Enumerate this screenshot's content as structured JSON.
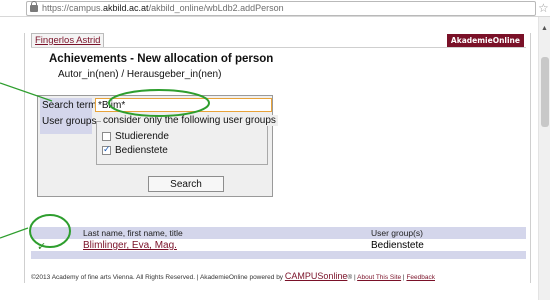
{
  "browser": {
    "url_prefix": "https://campus.",
    "url_host": "akbild.ac.at",
    "url_path": "/akbild_online/wbLdb2.addPerson"
  },
  "header": {
    "user_tab": "Fingerlos Astrid",
    "brand_badge": "AkademieOnline"
  },
  "main": {
    "title": "Achievements - New allocation of person",
    "subtitle": "Autor_in(nen) / Herausgeber_in(nen)"
  },
  "search": {
    "term_label": "Search term",
    "term_value": "*Blim*",
    "groups_label": "User groups",
    "groups_legend": "consider only the following user groups",
    "options": [
      {
        "label": "Studierende",
        "checked": false
      },
      {
        "label": "Bedienstete",
        "checked": true
      }
    ],
    "button_label": "Search"
  },
  "results": {
    "headers": [
      "Last name, first name, title",
      "User group(s)"
    ],
    "rows": [
      {
        "selected_mark": "✓",
        "name": "Blimlinger, Eva, Mag.",
        "group": "Bedienstete"
      }
    ]
  },
  "footer": {
    "copyright": "©2013 Academy of fine arts Vienna. All Rights Reserved. | AkademieOnline powered by ",
    "powered_brand": "CAMPUSonline",
    "registered": "®",
    "separator": " | ",
    "about_link": "About This Site",
    "feedback_link": "Feedback"
  },
  "colors": {
    "brand": "#7a1128",
    "label_bg": "#d4d6eb",
    "input_focus": "#e8a33a",
    "annotation": "#2e9e2e"
  }
}
